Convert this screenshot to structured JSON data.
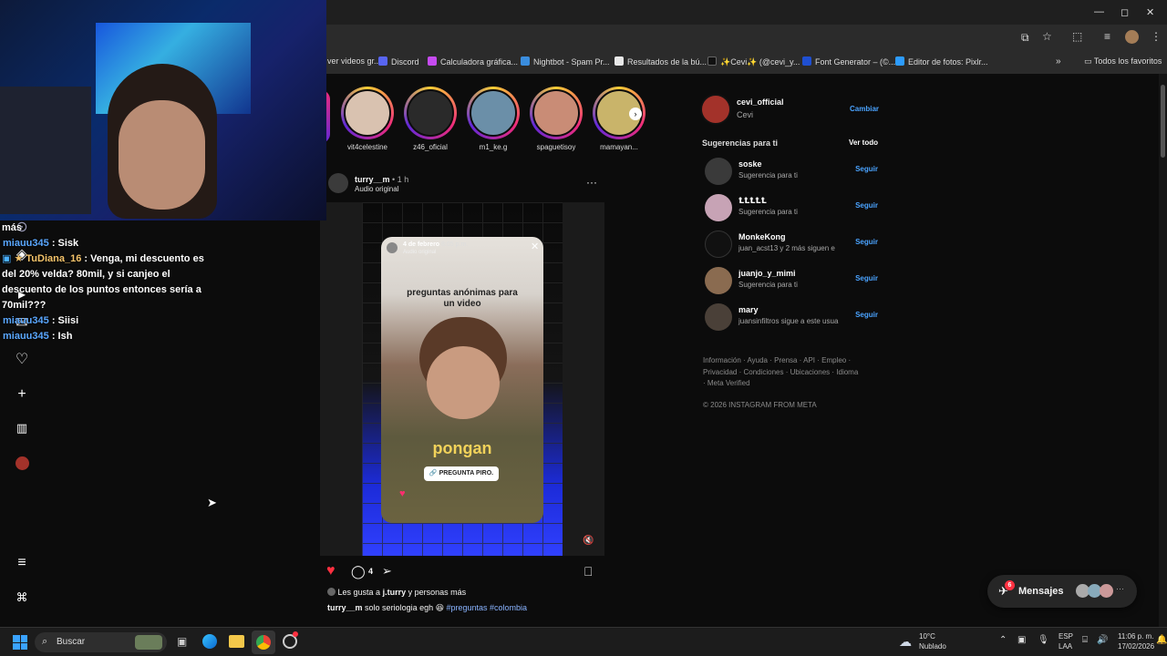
{
  "window": {
    "minimize": "—",
    "maximize": "◻",
    "close": "✕"
  },
  "bookmarks": [
    {
      "label": "ver videos gr...",
      "color": "#ffffff"
    },
    {
      "label": "Discord",
      "color": "#5865f2"
    },
    {
      "label": "Calculadora gráfica...",
      "color": "#c64bf0"
    },
    {
      "label": "Nightbot - Spam Pr...",
      "color": "#3a8dde"
    },
    {
      "label": "Resultados de la bú...",
      "color": "#e8e8e8"
    },
    {
      "label": "✨Cevi✨ (@cevi_y...",
      "color": "#111111"
    },
    {
      "label": "Font Generator – (©...",
      "color": "#1f4fd1"
    },
    {
      "label": "Editor de fotos: Pixlr...",
      "color": "#2d9cff"
    }
  ],
  "bookmarks_all": "Todos los favoritos",
  "chat": {
    "line0": "más",
    "m1_user": "miauu345",
    "m1_text": ": Sisk",
    "m2_user": "TuDiana_16",
    "m2_text": ": Venga, mi descuento es del 20% velda? 80mil, y si canjeo el descuento de los puntos entonces sería a 70mil???",
    "m3_user": "miauu345",
    "m3_text": ": Siisi",
    "m4_user": "miauu345",
    "m4_text": ": Ish"
  },
  "stories": [
    {
      "name": "vit4celestine",
      "color": "#d9c2b0"
    },
    {
      "name": "z46_oficial",
      "color": "#2a2a2a"
    },
    {
      "name": "m1_ke.g",
      "color": "#6b8fa8"
    },
    {
      "name": "spaguetisoy",
      "color": "#c98c76"
    },
    {
      "name": "mamayan...",
      "color": "#c9b46a"
    }
  ],
  "post": {
    "author": "turry__m",
    "time": "1 h",
    "audio": "Audio original",
    "story_date": "4 de febrero",
    "story_time": "8:05 p.m.",
    "story_audio": "Audio original",
    "story_title": "preguntas anónimas para un video",
    "caption_big": "pongan",
    "sticker": "PREGUNTA PIRO.",
    "comments": "4",
    "likes_prefix": "Les gusta a",
    "likes_user": "j.turry",
    "likes_suffix": "y personas más",
    "caption_user": "turry__m",
    "caption_text": "solo seriologia egh",
    "hashtags": "#preguntas #colombia"
  },
  "profile": {
    "username": "cevi_official",
    "name": "Cevi",
    "switch": "Cambiar"
  },
  "suggestions_title": "Sugerencias para ti",
  "see_all": "Ver todo",
  "follow_label": "Seguir",
  "suggestions": [
    {
      "name": "soske",
      "sub": "Sugerencia para ti",
      "color": "#3a3a3a"
    },
    {
      "name": "ꝈꝈꝈꝈꝈ",
      "sub": "Sugerencia para ti",
      "color": "#c7a3b5"
    },
    {
      "name": "MonkeKong",
      "sub": "juan_acst13 y 2 más siguen e",
      "color": "#111111"
    },
    {
      "name": "juanjo_y_mimi",
      "sub": "Sugerencia para ti",
      "color": "#8a6b50"
    },
    {
      "name": "mary",
      "sub": "juansinfiltros sigue a este usua",
      "color": "#4a4038"
    }
  ],
  "footer_links": "Información · Ayuda · Prensa · API · Empleo · Privacidad · Condiciones · Ubicaciones · Idioma · Meta Verified",
  "copyright": "© 2026 INSTAGRAM FROM META",
  "messages": {
    "label": "Mensajes",
    "badge": "6"
  },
  "taskbar": {
    "search": "Buscar",
    "weather_temp": "10°C",
    "weather_desc": "Nublado",
    "lang1": "ESP",
    "lang2": "LAA",
    "time": "11:06 p. m.",
    "date": "17/02/2026"
  },
  "colors": {
    "accent": "#4aa3ff",
    "like": "#ff3040",
    "bg": "#0c0c0c"
  }
}
